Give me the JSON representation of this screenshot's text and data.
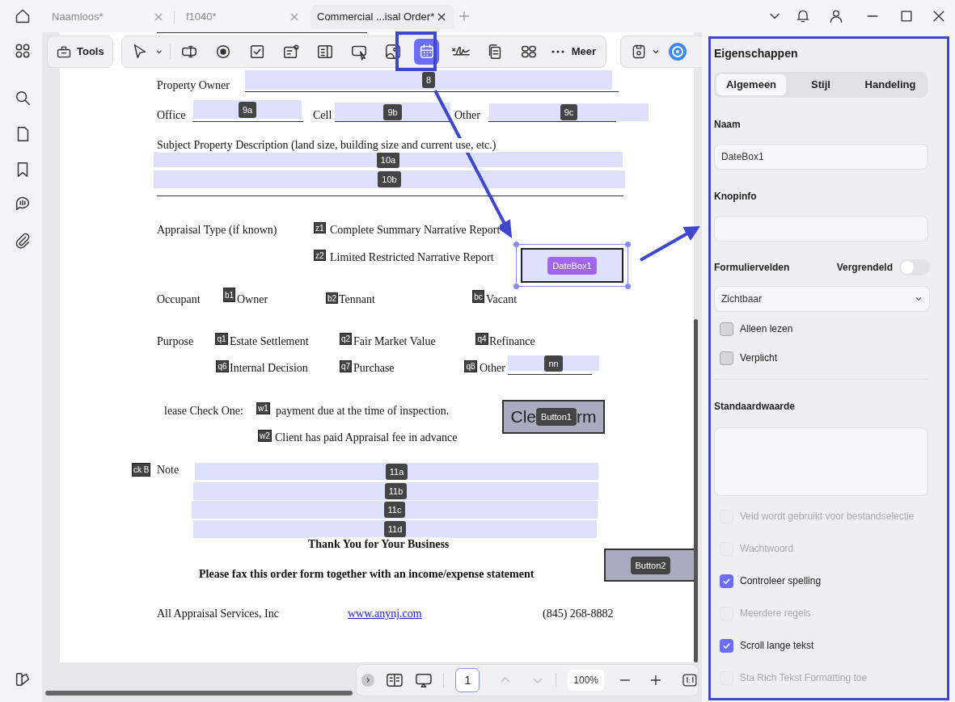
{
  "tabs": [
    {
      "label": "Naamloos*",
      "selected": false
    },
    {
      "label": "f1040*",
      "selected": false
    },
    {
      "label": "Commercial ...isal Order*",
      "selected": true
    }
  ],
  "toolbar": {
    "tools_button": "Tools",
    "more": "Meer",
    "tools": [
      {
        "kind": "select",
        "selected": false
      },
      {
        "kind": "text-field",
        "selected": false
      },
      {
        "kind": "radio",
        "selected": false
      },
      {
        "kind": "checkbox",
        "selected": false
      },
      {
        "kind": "combo",
        "selected": false
      },
      {
        "kind": "list",
        "selected": false
      },
      {
        "kind": "button",
        "selected": false
      },
      {
        "kind": "image",
        "selected": false
      },
      {
        "kind": "date",
        "selected": true
      },
      {
        "kind": "signature",
        "selected": false
      },
      {
        "kind": "copy",
        "selected": false
      },
      {
        "kind": "grid",
        "selected": false
      }
    ]
  },
  "document": {
    "texts": [
      {
        "text": "Property Owner",
        "kind": "label"
      },
      {
        "text": "Office",
        "kind": "label"
      },
      {
        "text": "Cell",
        "kind": "label"
      },
      {
        "text": "Other",
        "kind": "label"
      },
      {
        "text": "Subject Property Description (land size, building size and current use, etc.)",
        "kind": "label"
      },
      {
        "text": "Appraisal Type (if known)",
        "kind": "label"
      },
      {
        "text": "Complete Summary Narrative Report",
        "kind": "label"
      },
      {
        "text": "Limited Restricted Narrative Report",
        "kind": "label"
      },
      {
        "text": "Occupant",
        "kind": "label"
      },
      {
        "text": "Owner",
        "kind": "label"
      },
      {
        "text": "Tennant",
        "kind": "label"
      },
      {
        "text": "Vacant",
        "kind": "label"
      },
      {
        "text": "Purpose",
        "kind": "label"
      },
      {
        "text": "Estate Settlement",
        "kind": "label"
      },
      {
        "text": "Fair Market Value",
        "kind": "label"
      },
      {
        "text": "Refinance",
        "kind": "label"
      },
      {
        "text": "Internal Decision",
        "kind": "label"
      },
      {
        "text": "Purchase",
        "kind": "label"
      },
      {
        "text": "Other",
        "kind": "label"
      },
      {
        "text": "lease Check One:",
        "kind": "label"
      },
      {
        "text": "payment due at the time of inspection.",
        "kind": "label"
      },
      {
        "text": "Client has paid Appraisal fee in advance",
        "kind": "label"
      },
      {
        "text": "Note",
        "kind": "label"
      },
      {
        "text": "Thank You for Your Business",
        "kind": "heading"
      },
      {
        "text": "Please fax this order form together with an income/expense statement",
        "kind": "heading"
      },
      {
        "text": "All Appraisal Services, Inc",
        "kind": "label"
      },
      {
        "text": "www.anynj.com",
        "kind": "link"
      },
      {
        "text": "(845) 268-8882",
        "kind": "label"
      }
    ],
    "fields": [
      {
        "tag": "8",
        "kind": "text",
        "selected": false
      },
      {
        "tag": "9a",
        "kind": "text",
        "selected": false
      },
      {
        "tag": "9b",
        "kind": "text",
        "selected": false
      },
      {
        "tag": "9c",
        "kind": "text",
        "selected": false
      },
      {
        "tag": "10a",
        "kind": "text",
        "selected": false
      },
      {
        "tag": "10b",
        "kind": "text",
        "selected": false
      },
      {
        "tag": "z1",
        "kind": "checkbox",
        "selected": false
      },
      {
        "tag": "z2",
        "kind": "checkbox",
        "selected": false
      },
      {
        "tag": "DateBox1",
        "kind": "date",
        "selected": true
      },
      {
        "tag": "b1",
        "kind": "checkbox",
        "selected": false
      },
      {
        "tag": "b2",
        "kind": "checkbox",
        "selected": false
      },
      {
        "tag": "bc",
        "kind": "checkbox",
        "selected": false
      },
      {
        "tag": "q1",
        "kind": "checkbox",
        "selected": false
      },
      {
        "tag": "q2",
        "kind": "checkbox",
        "selected": false
      },
      {
        "tag": "q4",
        "kind": "checkbox",
        "selected": false
      },
      {
        "tag": "q6",
        "kind": "checkbox",
        "selected": false
      },
      {
        "tag": "q7",
        "kind": "checkbox",
        "selected": false
      },
      {
        "tag": "q8",
        "kind": "checkbox",
        "selected": false
      },
      {
        "tag": "nn",
        "kind": "text",
        "selected": false
      },
      {
        "tag": "w1",
        "kind": "checkbox",
        "selected": false
      },
      {
        "tag": "Button1",
        "kind": "button",
        "caption_left": "Cle",
        "caption_right": "rm",
        "selected": false
      },
      {
        "tag": "w2",
        "kind": "checkbox",
        "selected": false
      },
      {
        "tag": "ck B",
        "kind": "checkbox",
        "selected": false
      },
      {
        "tag": "11a",
        "kind": "text",
        "selected": false
      },
      {
        "tag": "11b",
        "kind": "text",
        "selected": false
      },
      {
        "tag": "11c",
        "kind": "text",
        "selected": false
      },
      {
        "tag": "11d",
        "kind": "text",
        "selected": false
      },
      {
        "tag": "Button2",
        "kind": "button",
        "selected": false
      }
    ]
  },
  "page_nav": {
    "page": "1",
    "zoom": "100%"
  },
  "properties": {
    "title": "Eigenschappen",
    "tabs": [
      {
        "label": "Algemeen",
        "selected": true
      },
      {
        "label": "Stijl",
        "selected": false
      },
      {
        "label": "Handeling",
        "selected": false
      }
    ],
    "name_label": "Naam",
    "name_value": "DateBox1",
    "tooltip_label": "Knopinfo",
    "form_fields_label": "Formuliervelden",
    "locked_label": "Vergrendeld",
    "locked": false,
    "visibility": "Zichtbaar",
    "options_top": [
      {
        "label": "Alleen lezen",
        "checked": false,
        "disabled": false
      },
      {
        "label": "Verplicht",
        "checked": false,
        "disabled": false
      }
    ],
    "default_label": "Standaardwaarde",
    "options": [
      {
        "label": "Veld wordt gebruikt voor bestandselectie",
        "checked": false,
        "disabled": true
      },
      {
        "label": "Wachtwoord",
        "checked": false,
        "disabled": true
      },
      {
        "label": "Controleer spelling",
        "checked": true,
        "disabled": false
      },
      {
        "label": "Meerdere regels",
        "checked": false,
        "disabled": true
      },
      {
        "label": "Scroll lange tekst",
        "checked": true,
        "disabled": false
      },
      {
        "label": "Sta Rich Tekst Formatting toe",
        "checked": false,
        "disabled": true
      }
    ]
  }
}
